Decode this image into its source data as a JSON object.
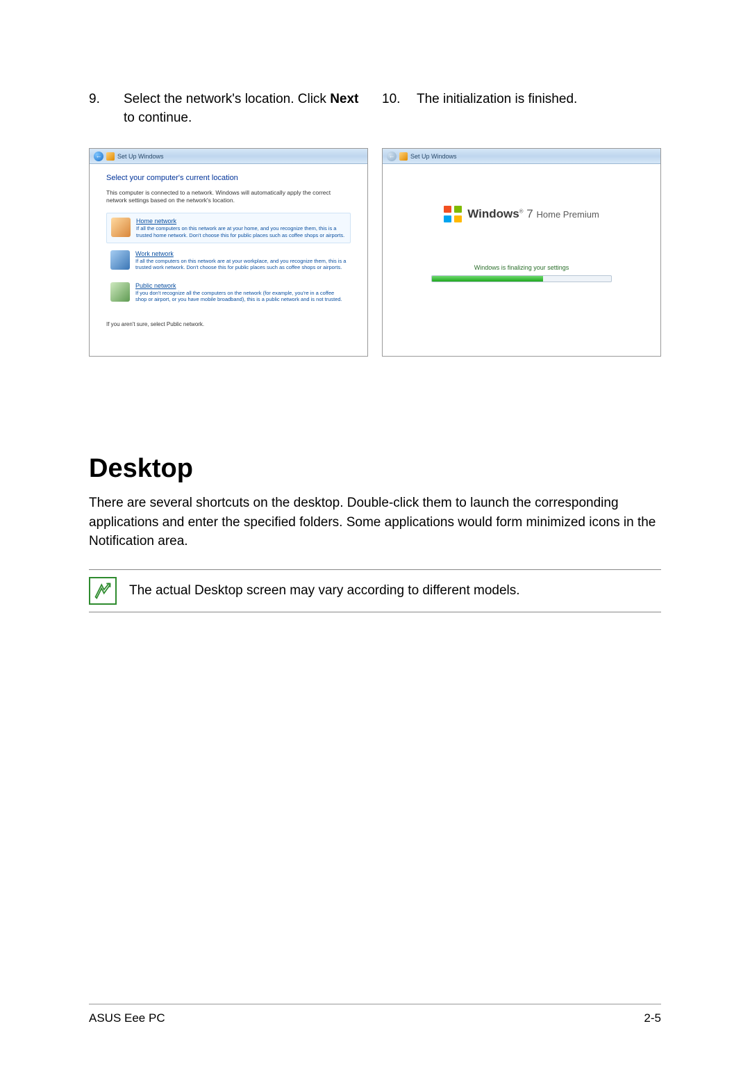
{
  "steps": {
    "s9": {
      "num": "9.",
      "text_a": "Select the network's location. Click ",
      "bold": "Next",
      "text_b": " to continue."
    },
    "s10": {
      "num": "10.",
      "text": "The initialization is finished."
    }
  },
  "screenshot1": {
    "header_title": "Set Up Windows",
    "heading": "Select your computer's current location",
    "sub": "This computer is connected to a network. Windows will automatically apply the correct network settings based on the network's location.",
    "options": [
      {
        "title": "Home network",
        "desc": "If all the computers on this network are at your home, and you recognize them, this is a trusted home network. Don't choose this for public places such as coffee shops or airports."
      },
      {
        "title": "Work network",
        "desc": "If all the computers on this network are at your workplace, and you recognize them, this is a trusted work network. Don't choose this for public places such as coffee shops or airports."
      },
      {
        "title": "Public network",
        "desc": "If you don't recognize all the computers on the network (for example, you're in a coffee shop or airport, or you have mobile broadband), this is a public network and is not trusted."
      }
    ],
    "footnote": "If you aren't sure, select Public network."
  },
  "screenshot2": {
    "header_title": "Set Up Windows",
    "logo_brand": "Windows",
    "logo_version": "7",
    "logo_edition": "Home Premium",
    "status": "Windows is finalizing your settings"
  },
  "section": {
    "title": "Desktop",
    "body": "There are several shortcuts on the desktop. Double-click them to launch the corresponding applications and enter the specified folders. Some applications would form minimized icons in the Notification area.",
    "note": "The actual Desktop screen may vary according to different models."
  },
  "footer": {
    "left": "ASUS Eee PC",
    "right": "2-5"
  }
}
